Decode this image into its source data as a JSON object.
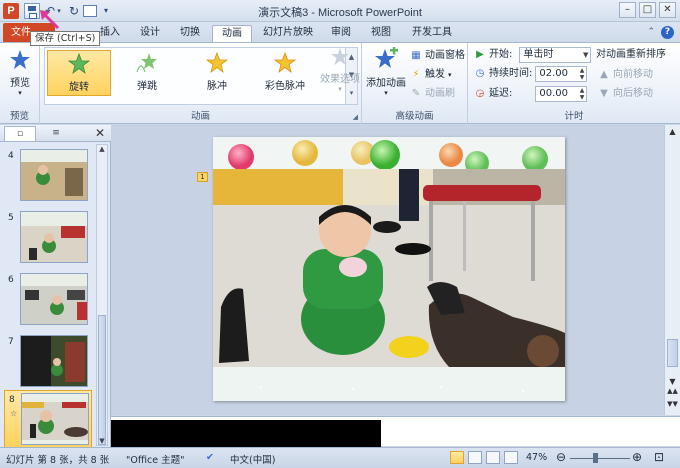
{
  "window": {
    "title": "演示文稿3 - Microsoft PowerPoint",
    "minimize": "–",
    "maximize": "□",
    "close": "✕"
  },
  "qat": {
    "logo": "P",
    "tooltip": "保存 (Ctrl+S)"
  },
  "tabs": {
    "file": "文件",
    "items": [
      {
        "label": "插入"
      },
      {
        "label": "设计"
      },
      {
        "label": "切换"
      },
      {
        "label": "动画"
      },
      {
        "label": "幻灯片放映"
      },
      {
        "label": "审阅"
      },
      {
        "label": "视图"
      },
      {
        "label": "开发工具"
      }
    ],
    "active": "动画",
    "help": "?"
  },
  "ribbon": {
    "preview": {
      "label": "预览",
      "button": "预览",
      "dropdown": "▾"
    },
    "animation": {
      "label": "动画",
      "effects": [
        {
          "label": "旋转",
          "selected": true
        },
        {
          "label": "弹跳"
        },
        {
          "label": "脉冲"
        },
        {
          "label": "彩色脉冲"
        }
      ],
      "effect_options": "效果选项"
    },
    "advanced": {
      "label": "高级动画",
      "add_animation": "添加动画",
      "animation_pane": "动画窗格",
      "trigger": "触发",
      "animation_painter": "动画刷"
    },
    "timing": {
      "label": "计时",
      "start_label": "开始:",
      "start_value": "单击时",
      "duration_label": "持续时间:",
      "duration_value": "02.00",
      "delay_label": "延迟:",
      "delay_value": "00.00",
      "reorder_title": "对动画重新排序",
      "move_earlier": "向前移动",
      "move_later": "向后移动"
    }
  },
  "slides_panel": {
    "slides": [
      {
        "number": "4"
      },
      {
        "number": "5"
      },
      {
        "number": "6"
      },
      {
        "number": "7"
      },
      {
        "number": "8",
        "selected": true,
        "star": "☆"
      }
    ]
  },
  "slide": {
    "anim_tag": "1"
  },
  "statusbar": {
    "slide_info": "幻灯片 第 8 张，共 8 张",
    "theme": "\"Office 主题\"",
    "language": "中文(中国)",
    "zoom": "47%"
  },
  "colors": {
    "accent": "#d24726",
    "selected_highlight": "#ffd25e",
    "ribbon_border": "#a5b7cf"
  }
}
